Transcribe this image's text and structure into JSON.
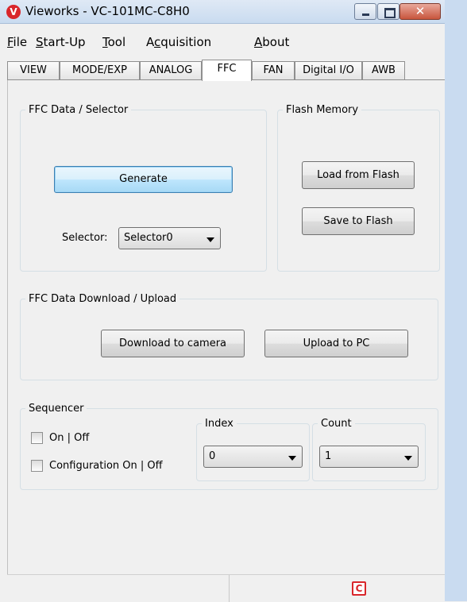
{
  "window": {
    "title": "Vieworks - VC-101MC-C8H0",
    "app_icon_glyph": "V",
    "close_glyph": "✕"
  },
  "menu": {
    "items": [
      {
        "label_u": "F",
        "label_rest": "ile"
      },
      {
        "label_u": "S",
        "label_rest": "tart-Up"
      },
      {
        "label_u": "T",
        "label_rest": "ool"
      },
      {
        "label_pre": "A",
        "label_u": "c",
        "label_rest": "quisition"
      },
      {
        "label_u": "A",
        "label_rest": "bout"
      }
    ]
  },
  "tabs": [
    "VIEW",
    "MODE/EXP",
    "ANALOG",
    "FFC",
    "FAN",
    "Digital I/O",
    "AWB"
  ],
  "active_tab": "FFC",
  "ffc_data": {
    "legend": "FFC Data / Selector",
    "generate_label": "Generate",
    "selector_label": "Selector:",
    "selector_value": "Selector0"
  },
  "flash": {
    "legend": "Flash Memory",
    "load_label": "Load from Flash",
    "save_label": "Save to Flash"
  },
  "download": {
    "legend": "FFC Data Download / Upload",
    "download_label": "Download to camera",
    "upload_label": "Upload to PC"
  },
  "sequencer": {
    "legend": "Sequencer",
    "on_off_label": "On | Off",
    "config_label": "Configuration On | Off",
    "index_legend": "Index",
    "index_value": "0",
    "count_legend": "Count",
    "count_value": "1"
  },
  "status": {
    "icon_glyph": "C"
  },
  "colors": {
    "accent_focus": "#3c7fb1",
    "brand_red": "#d9262b"
  }
}
